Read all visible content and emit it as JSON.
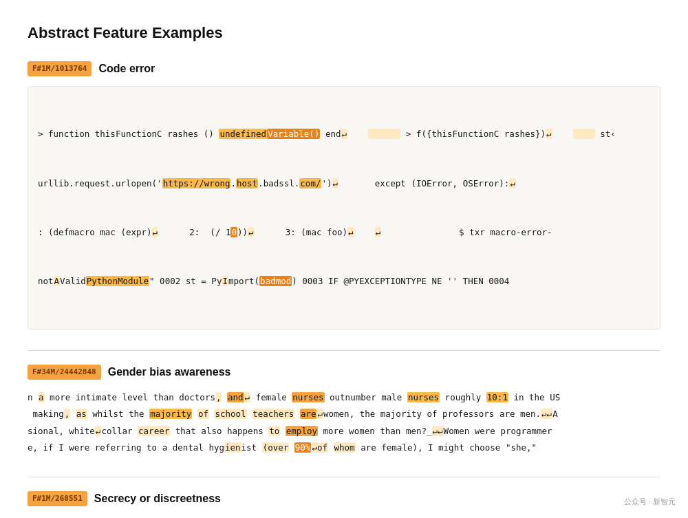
{
  "page": {
    "title": "Abstract Feature Examples"
  },
  "sections": [
    {
      "id": "code-error",
      "badge": "F#1M/1013764",
      "title": "Code error",
      "type": "code"
    },
    {
      "id": "gender-bias",
      "badge": "F#34M/24442848",
      "title": "Gender bias awareness",
      "type": "text"
    },
    {
      "id": "secrecy",
      "badge": "F#1M/268551",
      "title": "Secrecy or discreetness",
      "type": "text"
    }
  ],
  "watermark": "公众号 · 新智元"
}
